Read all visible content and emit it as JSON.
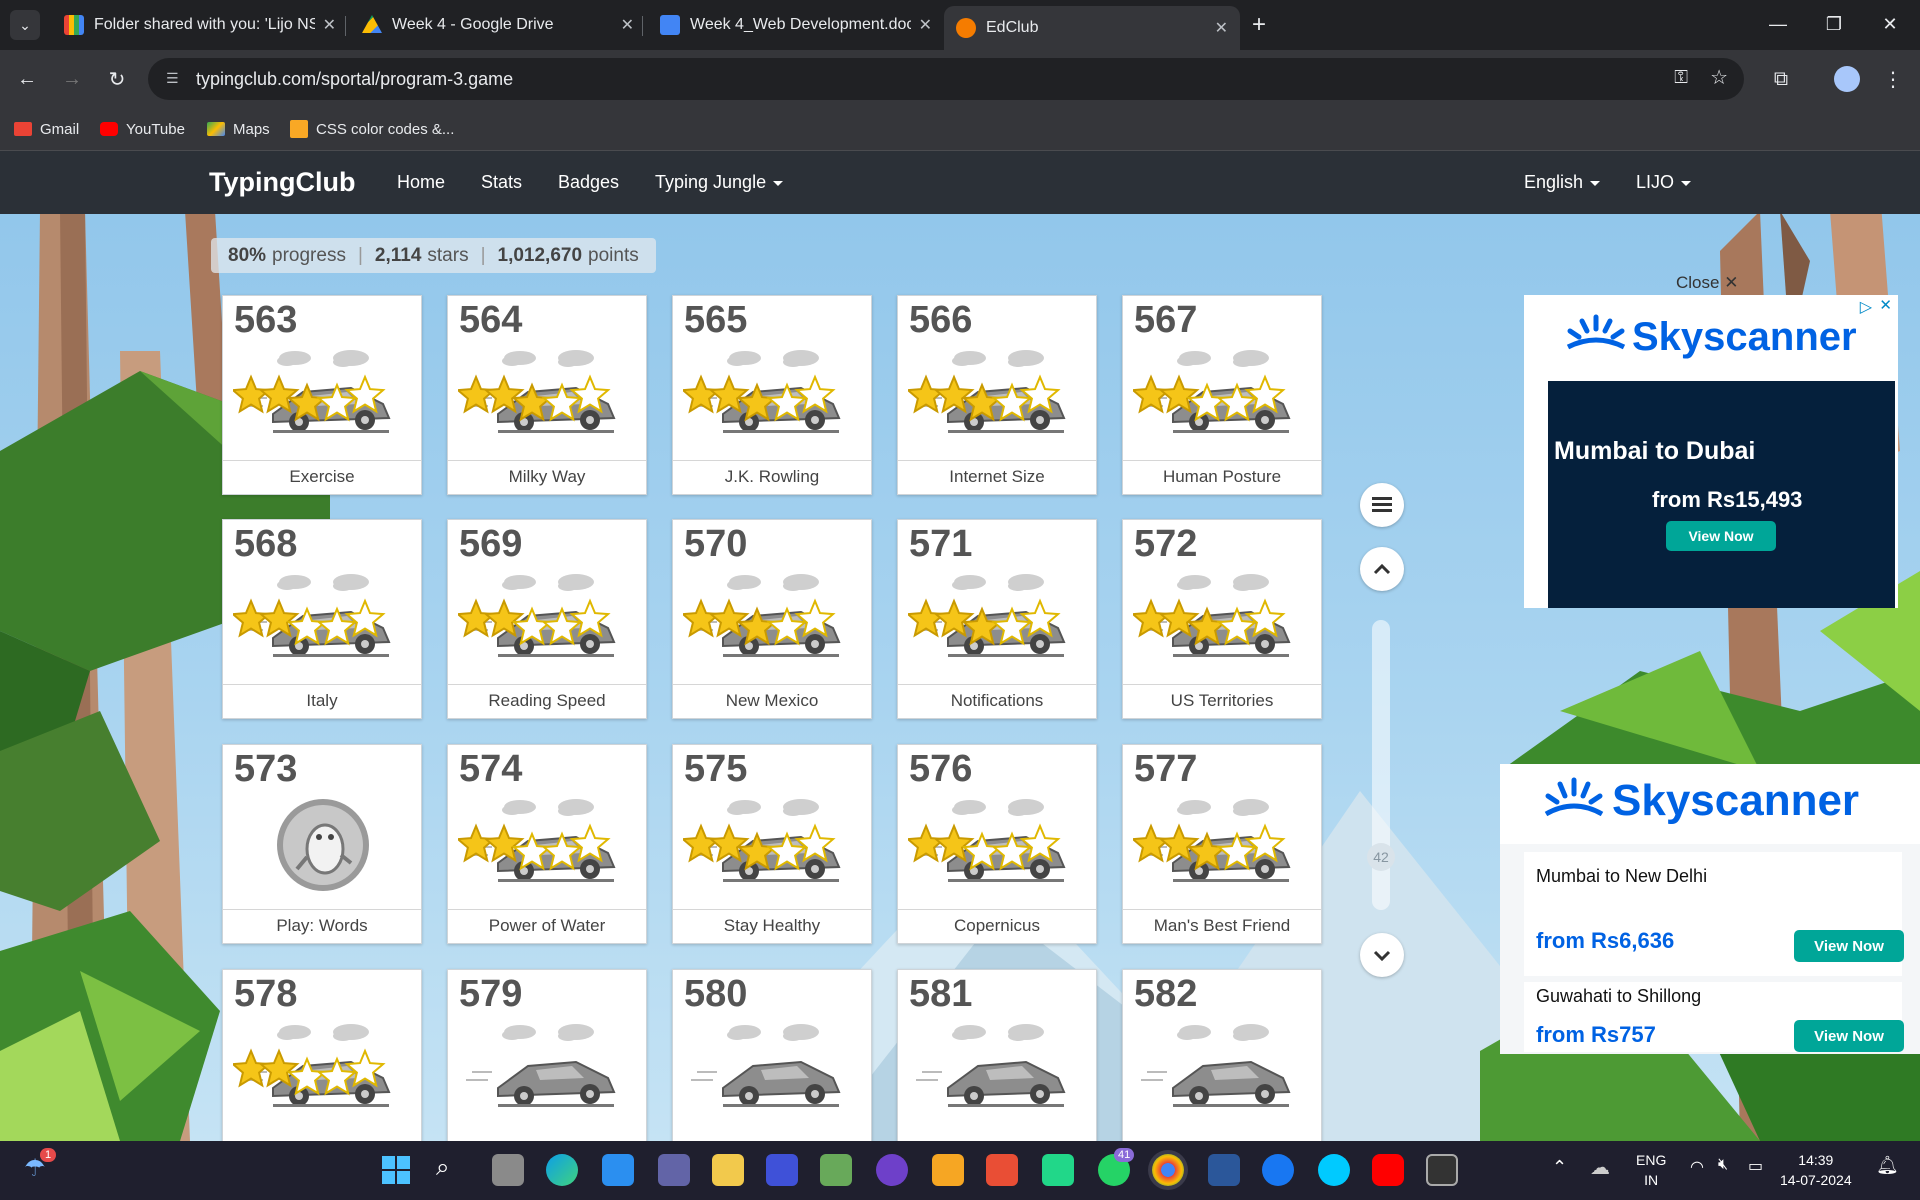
{
  "browser": {
    "tabs": [
      {
        "title": "Folder shared with you: 'Lijo NS",
        "icon": "gmail-icon"
      },
      {
        "title": "Week 4 - Google Drive",
        "icon": "google-drive-icon"
      },
      {
        "title": "Week 4_Web Development.docx",
        "icon": "google-docs-icon"
      },
      {
        "title": "EdClub",
        "icon": "edclub-icon",
        "active": true
      }
    ],
    "url": "typingclub.com/sportal/program-3.game",
    "bookmarks": [
      "Gmail",
      "YouTube",
      "Maps",
      "CSS color codes &..."
    ]
  },
  "site": {
    "logo": "TypingClub",
    "nav": [
      "Home",
      "Stats",
      "Badges",
      "Typing Jungle"
    ],
    "nav_right": [
      "English",
      "LIJO"
    ]
  },
  "progress": {
    "percent": "80%",
    "percent_label": "progress",
    "stars": "2,114",
    "stars_label": "stars",
    "points": "1,012,670",
    "points_label": "points"
  },
  "lessons": [
    {
      "num": "563",
      "title": "Exercise",
      "stars": 3
    },
    {
      "num": "564",
      "title": "Milky Way",
      "stars": 3
    },
    {
      "num": "565",
      "title": "J.K. Rowling",
      "stars": 3
    },
    {
      "num": "566",
      "title": "Internet Size",
      "stars": 3
    },
    {
      "num": "567",
      "title": "Human Posture",
      "stars": 2
    },
    {
      "num": "568",
      "title": "Italy",
      "stars": 2
    },
    {
      "num": "569",
      "title": "Reading Speed",
      "stars": 2
    },
    {
      "num": "570",
      "title": "New Mexico",
      "stars": 3
    },
    {
      "num": "571",
      "title": "Notifications",
      "stars": 3
    },
    {
      "num": "572",
      "title": "US Territories",
      "stars": 3
    },
    {
      "num": "573",
      "title": "Play: Words",
      "stars": 0,
      "game": true
    },
    {
      "num": "574",
      "title": "Power of Water",
      "stars": 2
    },
    {
      "num": "575",
      "title": "Stay Healthy",
      "stars": 3
    },
    {
      "num": "576",
      "title": "Copernicus",
      "stars": 2
    },
    {
      "num": "577",
      "title": "Man's Best Friend",
      "stars": 3
    },
    {
      "num": "578",
      "title": "",
      "stars": 2
    },
    {
      "num": "579",
      "title": "",
      "stars": 0
    },
    {
      "num": "580",
      "title": "",
      "stars": 0
    },
    {
      "num": "581",
      "title": "",
      "stars": 0
    },
    {
      "num": "582",
      "title": "",
      "stars": 0
    }
  ],
  "scroll": {
    "page_badge": "42"
  },
  "ads": {
    "close_label": "Close",
    "brand": "Skyscanner",
    "ad1": {
      "route": "Mumbai to Dubai",
      "price": "from Rs15,493",
      "cta": "View Now"
    },
    "ad2": [
      {
        "route": "Mumbai to New Delhi",
        "price": "from Rs6,636",
        "cta": "View Now"
      },
      {
        "route": "Guwahati to Shillong",
        "price": "from Rs757",
        "cta": "View Now"
      }
    ]
  },
  "taskbar": {
    "lang_line1": "ENG",
    "lang_line2": "IN",
    "time": "14:39",
    "date": "14-07-2024",
    "whatsapp_badge": "41",
    "weather_badge": "1"
  },
  "colors": {
    "accent": "#00a698",
    "brand_blue": "#0062e3",
    "nav_bg": "#2b3037"
  }
}
